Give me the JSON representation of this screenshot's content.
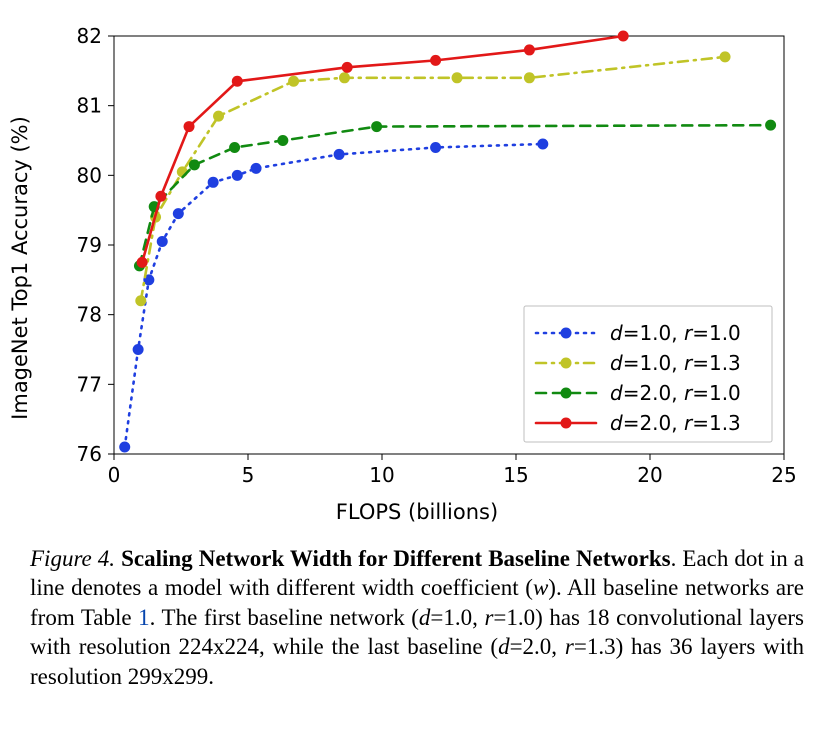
{
  "chart_data": {
    "type": "line",
    "xlabel": "FLOPS (billions)",
    "ylabel": "ImageNet Top1 Accuracy (%)",
    "xlim": [
      0,
      25
    ],
    "ylim": [
      76,
      82
    ],
    "xticks": [
      0,
      5,
      10,
      15,
      20,
      25
    ],
    "yticks": [
      76,
      77,
      78,
      79,
      80,
      81,
      82
    ],
    "series": [
      {
        "name": "d=1.0, r=1.0",
        "legend_parts": [
          "d",
          "=1.0, ",
          "r",
          "=1.0"
        ],
        "color": "#1f3fe0",
        "dash": "dot",
        "x": [
          0.4,
          0.9,
          1.3,
          1.8,
          2.4,
          3.7,
          4.6,
          5.3,
          8.4,
          12.0,
          16.0
        ],
        "y": [
          76.1,
          77.5,
          78.5,
          79.05,
          79.45,
          79.9,
          80.0,
          80.1,
          80.3,
          80.4,
          80.45
        ]
      },
      {
        "name": "d=1.0, r=1.3",
        "legend_parts": [
          "d",
          "=1.0, ",
          "r",
          "=1.3"
        ],
        "color": "#c0c427",
        "dash": "dashdot",
        "x": [
          1.0,
          1.55,
          2.55,
          3.9,
          6.7,
          8.6,
          12.8,
          15.5,
          22.8
        ],
        "y": [
          78.2,
          79.4,
          80.05,
          80.85,
          81.35,
          81.4,
          81.4,
          81.4,
          81.7
        ]
      },
      {
        "name": "d=2.0, r=1.0",
        "legend_parts": [
          "d",
          "=2.0, ",
          "r",
          "=1.0"
        ],
        "color": "#118a11",
        "dash": "dash",
        "x": [
          0.95,
          1.5,
          3.0,
          4.5,
          6.3,
          9.8,
          24.5
        ],
        "y": [
          78.7,
          79.55,
          80.15,
          80.4,
          80.5,
          80.7,
          80.72
        ]
      },
      {
        "name": "d=2.0, r=1.3",
        "legend_parts": [
          "d",
          "=2.0, ",
          "r",
          "=1.3"
        ],
        "color": "#e21818",
        "dash": "solid",
        "x": [
          1.05,
          1.75,
          2.8,
          4.6,
          8.7,
          12.0,
          15.5,
          19.0
        ],
        "y": [
          78.75,
          79.7,
          80.7,
          81.35,
          81.55,
          81.65,
          81.8,
          82.0
        ]
      }
    ]
  },
  "caption": {
    "fig_label": "Figure 4.",
    "title": "Scaling Network Width for Different Baseline Networks",
    "body_1": ". Each dot in a line denotes a model with different width coefficient (",
    "var_w": "w",
    "body_2": "). All baseline networks are from Table ",
    "table_ref": "1",
    "body_3": ". The first baseline network (",
    "var_d1": "d",
    "body_4": "=1.0, ",
    "var_r1": "r",
    "body_5": "=1.0) has 18 convolutional layers with resolution 224x224, while the last baseline (",
    "var_d2": "d",
    "body_6": "=2.0, ",
    "var_r2": "r",
    "body_7": "=1.3) has 36 layers with resolution 299x299."
  }
}
